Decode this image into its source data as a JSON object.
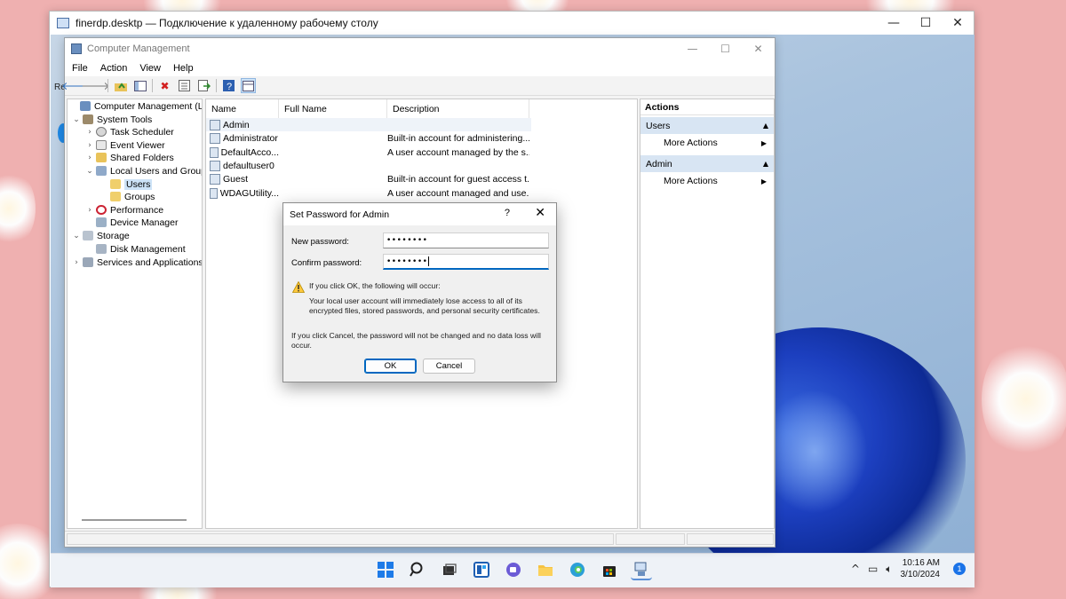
{
  "rdp": {
    "title": "finerdp.desktp — Подключение к удаленному рабочему столу",
    "controls": {
      "minimize": "—",
      "maximize": "☐",
      "close": "✕"
    }
  },
  "computer_management": {
    "title": "Computer Management",
    "menu": [
      "File",
      "Action",
      "View",
      "Help"
    ],
    "tree": [
      {
        "label": "Computer Management (Local",
        "icon": "computer-icon"
      },
      {
        "label": "System Tools",
        "icon": "tools-icon"
      },
      {
        "label": "Task Scheduler",
        "icon": "clock-icon"
      },
      {
        "label": "Event Viewer",
        "icon": "event-viewer-icon"
      },
      {
        "label": "Shared Folders",
        "icon": "shared-folder-icon"
      },
      {
        "label": "Local Users and Groups",
        "icon": "users-groups-icon"
      },
      {
        "label": "Users",
        "icon": "folder-icon"
      },
      {
        "label": "Groups",
        "icon": "folder-icon"
      },
      {
        "label": "Performance",
        "icon": "performance-icon"
      },
      {
        "label": "Device Manager",
        "icon": "device-manager-icon"
      },
      {
        "label": "Storage",
        "icon": "storage-icon"
      },
      {
        "label": "Disk Management",
        "icon": "disk-icon"
      },
      {
        "label": "Services and Applications",
        "icon": "services-icon"
      }
    ],
    "list_headers": [
      "Name",
      "Full Name",
      "Description"
    ],
    "users": [
      {
        "name": "Admin",
        "full_name": "",
        "description": ""
      },
      {
        "name": "Administrator",
        "full_name": "",
        "description": "Built-in account for administering..."
      },
      {
        "name": "DefaultAcco...",
        "full_name": "",
        "description": "A user account managed by the s..."
      },
      {
        "name": "defaultuser0",
        "full_name": "",
        "description": ""
      },
      {
        "name": "Guest",
        "full_name": "",
        "description": "Built-in account for guest access t..."
      },
      {
        "name": "WDAGUtility...",
        "full_name": "",
        "description": "A user account managed and use..."
      }
    ],
    "actions": {
      "header": "Actions",
      "sections": [
        {
          "title": "Users",
          "item": "More Actions"
        },
        {
          "title": "Admin",
          "item": "More Actions"
        }
      ]
    }
  },
  "dialog": {
    "title": "Set Password for Admin",
    "help": "?",
    "new_password_label": "New password:",
    "new_password_value": "••••••••",
    "confirm_password_label": "Confirm password:",
    "confirm_password_value": "••••••••",
    "warning_heading": "If you click OK, the following will occur:",
    "warning_body_1": "Your local user account will immediately lose access to all of its",
    "warning_body_2": "encrypted files, stored passwords, and personal security certificates.",
    "cancel_note_1": "If you click Cancel, the password will not be changed and no data loss will",
    "cancel_note_2": "occur.",
    "ok_label": "OK",
    "cancel_label": "Cancel"
  },
  "taskbar": {
    "icons": [
      "windows-start-icon",
      "search-icon",
      "task-view-icon",
      "widgets-icon",
      "chat-icon",
      "file-explorer-icon",
      "edge-icon",
      "store-icon",
      "computer-management-icon"
    ],
    "time": "10:16 AM",
    "date": "3/10/2024",
    "notification_count": "1"
  },
  "colors": {
    "accent": "#0067c0",
    "selection": "#cde3f7",
    "action_section": "#d8e5f3"
  }
}
